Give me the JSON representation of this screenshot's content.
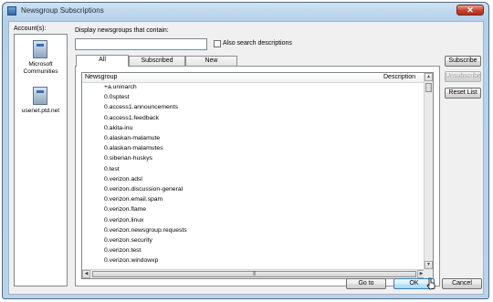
{
  "window": {
    "title": "Newsgroup Subscriptions",
    "close_glyph": "✕"
  },
  "accounts": {
    "label": "Account(s):",
    "items": [
      {
        "label": "Microsoft Communities",
        "icon": "server-icon"
      },
      {
        "label": "usenet.ptd.net",
        "icon": "server-icon"
      }
    ]
  },
  "search": {
    "label": "Display newsgroups that contain:",
    "value": "",
    "also_search_label": "Also search descriptions",
    "also_search_checked": false
  },
  "tabs": [
    "All",
    "Subscribed",
    "New"
  ],
  "active_tab": "All",
  "list": {
    "columns": [
      "Newsgroup",
      "Description"
    ],
    "rows": [
      "+a.uninarch",
      "0.0sptest",
      "0.access1.announcements",
      "0.access1.feedback",
      "0.akita-inu",
      "0.alaskan-malamute",
      "0.alaskan-malamutes",
      "0.siberian-huskys",
      "0.test",
      "0.verizon.adsl",
      "0.verizon.discussion-general",
      "0.verizon.email.spam",
      "0.verizon.flame",
      "0.verizon.linux",
      "0.verizon.newsgroup.requests",
      "0.verizon.security",
      "0.verizon.test",
      "0.verizon.windowxp"
    ]
  },
  "side_buttons": {
    "subscribe": "Subscribe",
    "unsubscribe": "Unsubscribe",
    "reset_list": "Reset List"
  },
  "footer_buttons": {
    "goto": "Go to",
    "ok": "OK",
    "cancel": "Cancel"
  }
}
